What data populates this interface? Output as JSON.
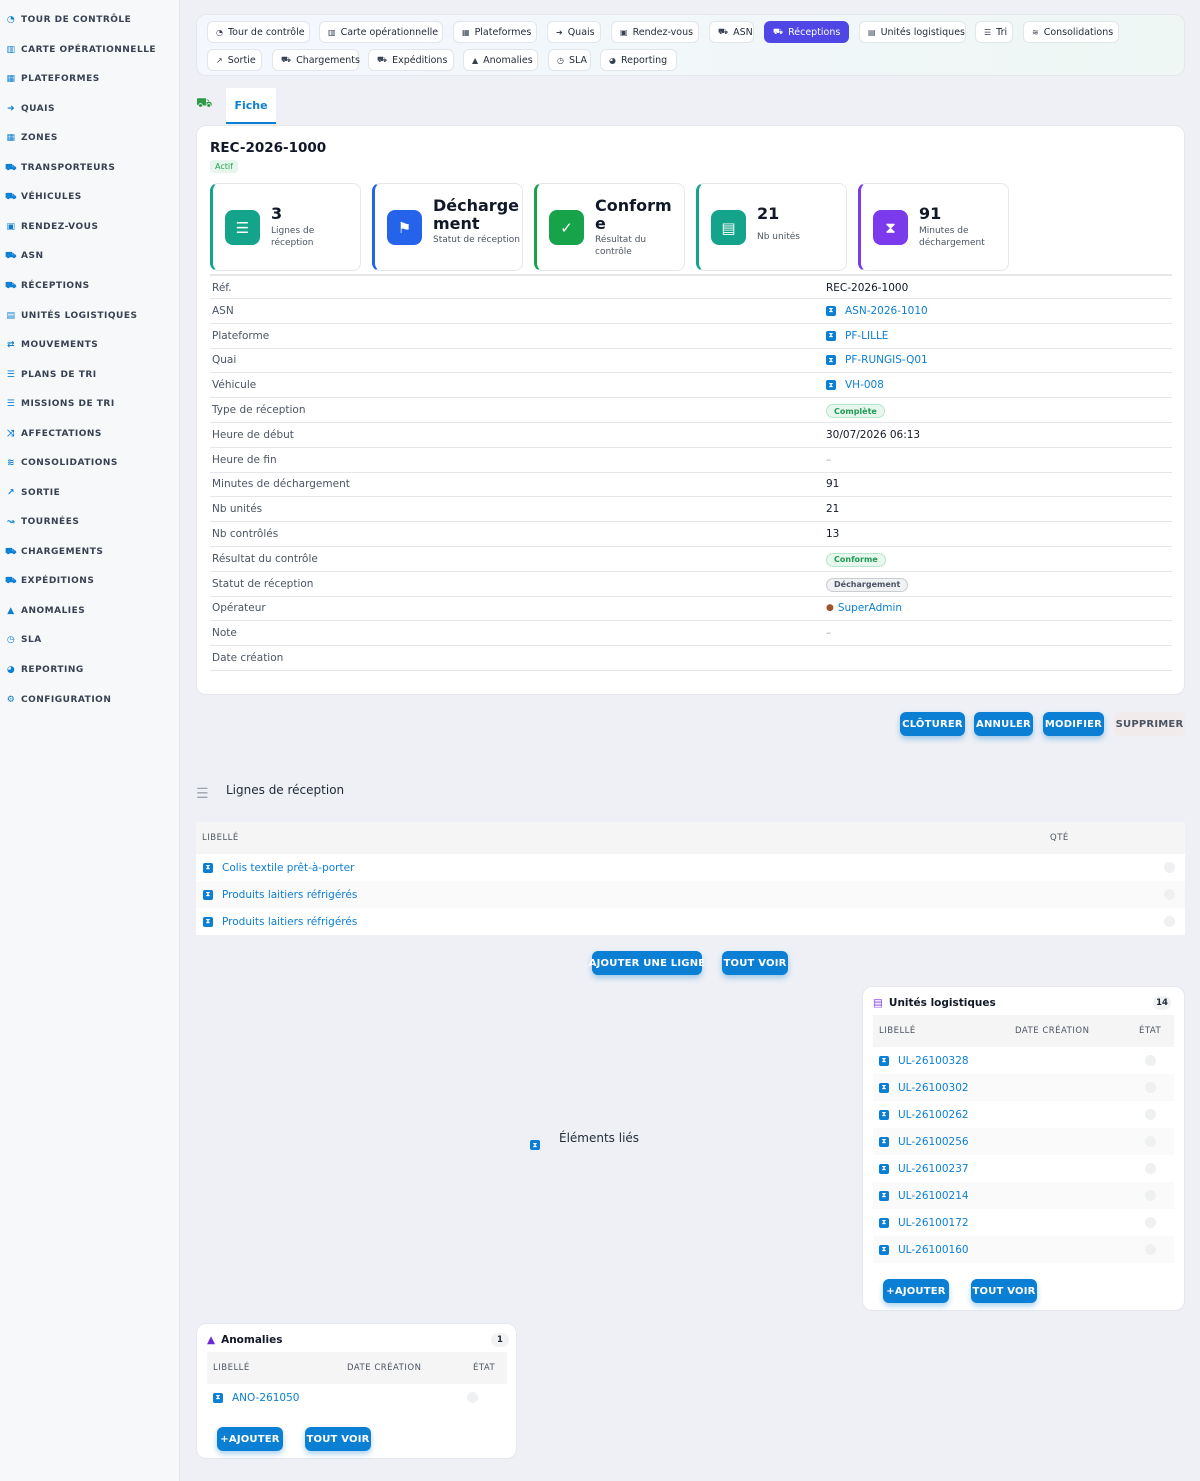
{
  "sidebar": {
    "items": [
      {
        "label": "TOUR DE CONTRÔLE",
        "icon": "gauge-icon"
      },
      {
        "label": "CARTE OPÉRATIONNELLE",
        "icon": "map-icon"
      },
      {
        "label": "PLATEFORMES",
        "icon": "warehouse-icon"
      },
      {
        "label": "QUAIS",
        "icon": "dock-icon"
      },
      {
        "label": "ZONES",
        "icon": "grid-icon"
      },
      {
        "label": "TRANSPORTEURS",
        "icon": "truck-icon"
      },
      {
        "label": "VÉHICULES",
        "icon": "van-icon"
      },
      {
        "label": "RENDEZ-VOUS",
        "icon": "calendar-icon"
      },
      {
        "label": "ASN",
        "icon": "truck-ramp-icon"
      },
      {
        "label": "RÉCEPTIONS",
        "icon": "dolly-icon"
      },
      {
        "label": "UNITÉS LOGISTIQUES",
        "icon": "pallet-icon"
      },
      {
        "label": "MOUVEMENTS",
        "icon": "arrows-icon"
      },
      {
        "label": "PLANS DE TRI",
        "icon": "list-icon"
      },
      {
        "label": "MISSIONS DE TRI",
        "icon": "list-check-icon"
      },
      {
        "label": "AFFECTATIONS",
        "icon": "shuffle-icon"
      },
      {
        "label": "CONSOLIDATIONS",
        "icon": "layers-icon"
      },
      {
        "label": "SORTIE",
        "icon": "exit-icon"
      },
      {
        "label": "TOURNÉES",
        "icon": "route-icon"
      },
      {
        "label": "CHARGEMENTS",
        "icon": "loading-icon"
      },
      {
        "label": "EXPÉDITIONS",
        "icon": "shipping-icon"
      },
      {
        "label": "ANOMALIES",
        "icon": "warning-icon"
      },
      {
        "label": "SLA",
        "icon": "stopwatch-icon"
      },
      {
        "label": "REPORTING",
        "icon": "chart-pie-icon"
      },
      {
        "label": "CONFIGURATION",
        "icon": "gear-icon"
      }
    ]
  },
  "topnav": {
    "chips": [
      {
        "label": "Tour de contrôle",
        "icon": "gauge-icon"
      },
      {
        "label": "Carte opérationnelle",
        "icon": "map-icon"
      },
      {
        "label": "Plateformes",
        "icon": "warehouse-icon"
      },
      {
        "label": "Quais",
        "icon": "dock-icon"
      },
      {
        "label": "Rendez-vous",
        "icon": "calendar-icon"
      },
      {
        "label": "ASN",
        "icon": "truck-ramp-icon"
      },
      {
        "label": "Réceptions",
        "icon": "dolly-icon",
        "active": true
      },
      {
        "label": "Unités logistiques",
        "icon": "pallet-icon"
      },
      {
        "label": "Tri",
        "icon": "list-icon"
      },
      {
        "label": "Consolidations",
        "icon": "layers-icon"
      },
      {
        "label": "Sortie",
        "icon": "exit-icon"
      },
      {
        "label": "Chargements",
        "icon": "loading-icon"
      },
      {
        "label": "Expéditions",
        "icon": "shipping-icon"
      },
      {
        "label": "Anomalies",
        "icon": "warning-icon"
      },
      {
        "label": "SLA",
        "icon": "stopwatch-icon"
      },
      {
        "label": "Reporting",
        "icon": "chart-pie-icon"
      }
    ]
  },
  "tabs": {
    "fiche": "Fiche"
  },
  "record": {
    "title": "REC-2026-1000",
    "status": "Actif",
    "kpis": [
      {
        "value": "3",
        "label": "Lignes de réception",
        "color": "#14a38b",
        "icon": "list-icon"
      },
      {
        "value": "Décharge ment",
        "label": "Statut de réception",
        "color": "#2563eb",
        "icon": "flag-icon"
      },
      {
        "value": "Conform e",
        "label": "Résultat du contrôle",
        "color": "#16a34a",
        "icon": "clipboard-check-icon"
      },
      {
        "value": "21",
        "label": "Nb unités",
        "color": "#14a38b",
        "icon": "pallet-icon"
      },
      {
        "value": "91",
        "label": "Minutes de déchargement",
        "color": "#7c3aed",
        "icon": "hourglass-icon"
      }
    ],
    "fields": [
      {
        "label": "Réf.",
        "value": "REC-2026-1000"
      },
      {
        "label": "ASN",
        "value": "ASN-2026-1010",
        "kind": "link"
      },
      {
        "label": "Plateforme",
        "value": "PF-LILLE",
        "kind": "link"
      },
      {
        "label": "Quai",
        "value": "PF-RUNGIS-Q01",
        "kind": "link"
      },
      {
        "label": "Véhicule",
        "value": "VH-008",
        "kind": "link"
      },
      {
        "label": "Type de réception",
        "value": "Complète",
        "kind": "pill-green"
      },
      {
        "label": "Heure de début",
        "value": "30/07/2026 06:13"
      },
      {
        "label": "Heure de fin",
        "value": "–",
        "kind": "muted"
      },
      {
        "label": "Minutes de déchargement",
        "value": "91"
      },
      {
        "label": "Nb unités",
        "value": "21"
      },
      {
        "label": "Nb contrôlés",
        "value": "13"
      },
      {
        "label": "Résultat du contrôle",
        "value": "Conforme",
        "kind": "pill-green"
      },
      {
        "label": "Statut de réception",
        "value": "Déchargement",
        "kind": "pill-gray"
      },
      {
        "label": "Opérateur",
        "value": "SuperAdmin",
        "kind": "user"
      },
      {
        "label": "Note",
        "value": "–",
        "kind": "muted"
      },
      {
        "label": "Date création",
        "value": ""
      }
    ]
  },
  "actions": {
    "cloturer": "CLÔTURER",
    "annuler": "ANNULER",
    "modifier": "MODIFIER",
    "supprimer": "SUPPRIMER"
  },
  "lines": {
    "title": "Lignes de réception",
    "col_label": "LIBELLÉ",
    "col_qty": "QTÉ",
    "rows": [
      "Colis textile prêt-à-porter",
      "Produits laitiers réfrigérés",
      "Produits laitiers réfrigérés"
    ],
    "add_label": "AJOUTER UNE LIGNE",
    "see_all_label": "TOUT VOIR"
  },
  "linked": {
    "title": "Éléments liés"
  },
  "units_panel": {
    "title": "Unités logistiques",
    "count": "14",
    "col_label": "LIBELLÉ",
    "col_date": "DATE CRÉATION",
    "col_state": "ÉTAT",
    "rows": [
      "UL-26100328",
      "UL-26100302",
      "UL-26100262",
      "UL-26100256",
      "UL-26100237",
      "UL-26100214",
      "UL-26100172",
      "UL-26100160"
    ],
    "add_label": "AJOUTER",
    "see_all_label": "TOUT VOIR"
  },
  "anomalies_panel": {
    "title": "Anomalies",
    "count": "1",
    "col_label": "LIBELLÉ",
    "col_date": "DATE CRÉATION",
    "col_state": "ÉTAT",
    "rows": [
      "ANO-261050"
    ],
    "add_label": "AJOUTER",
    "see_all_label": "TOUT VOIR"
  }
}
